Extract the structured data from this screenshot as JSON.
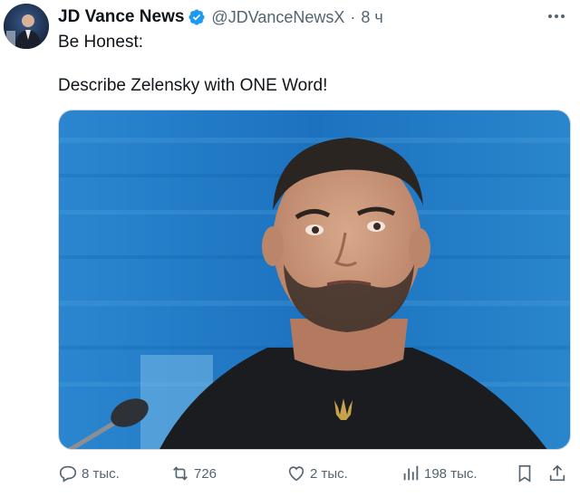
{
  "tweet": {
    "author_name": "JD Vance News",
    "handle": "@JDVanceNewsX",
    "separator": "·",
    "time": "8 ч",
    "line1": "Be Honest:",
    "line2": "Describe Zelensky with ONE Word!"
  },
  "actions": {
    "replies": "8 тыс.",
    "reposts": "726",
    "likes": "2 тыс.",
    "views": "198 тыс."
  },
  "colors": {
    "verified": "#1d9bf0",
    "secondary_text": "#536471",
    "media_background": "#1e78c8"
  },
  "icons": [
    "verified-badge-icon",
    "more-icon",
    "reply-icon",
    "repost-icon",
    "like-icon",
    "views-icon",
    "bookmark-icon",
    "share-icon"
  ]
}
